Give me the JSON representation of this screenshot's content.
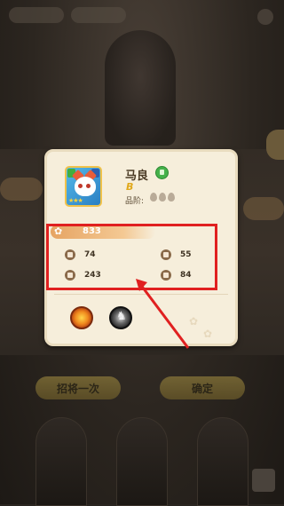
{
  "hero": {
    "name": "马良",
    "grade": "B",
    "quality_label": "品阶:",
    "quality_drops": 3,
    "portrait_stars": "★★★"
  },
  "power": {
    "value": "833"
  },
  "stats": [
    {
      "icon": "brush-icon",
      "value": "74"
    },
    {
      "icon": "shield-icon",
      "value": "55"
    },
    {
      "icon": "heart-icon",
      "value": "243"
    },
    {
      "icon": "boot-icon",
      "value": "84"
    }
  ],
  "skills": [
    {
      "icon": "fire-skill-icon"
    },
    {
      "icon": "ghost-skill-icon"
    }
  ],
  "buttons": {
    "recruit_again": "招将一次",
    "confirm": "确定"
  },
  "colors": {
    "highlight": "#e02020",
    "popup_bg": "#f6eedb",
    "power_bar": "#e6a463"
  }
}
